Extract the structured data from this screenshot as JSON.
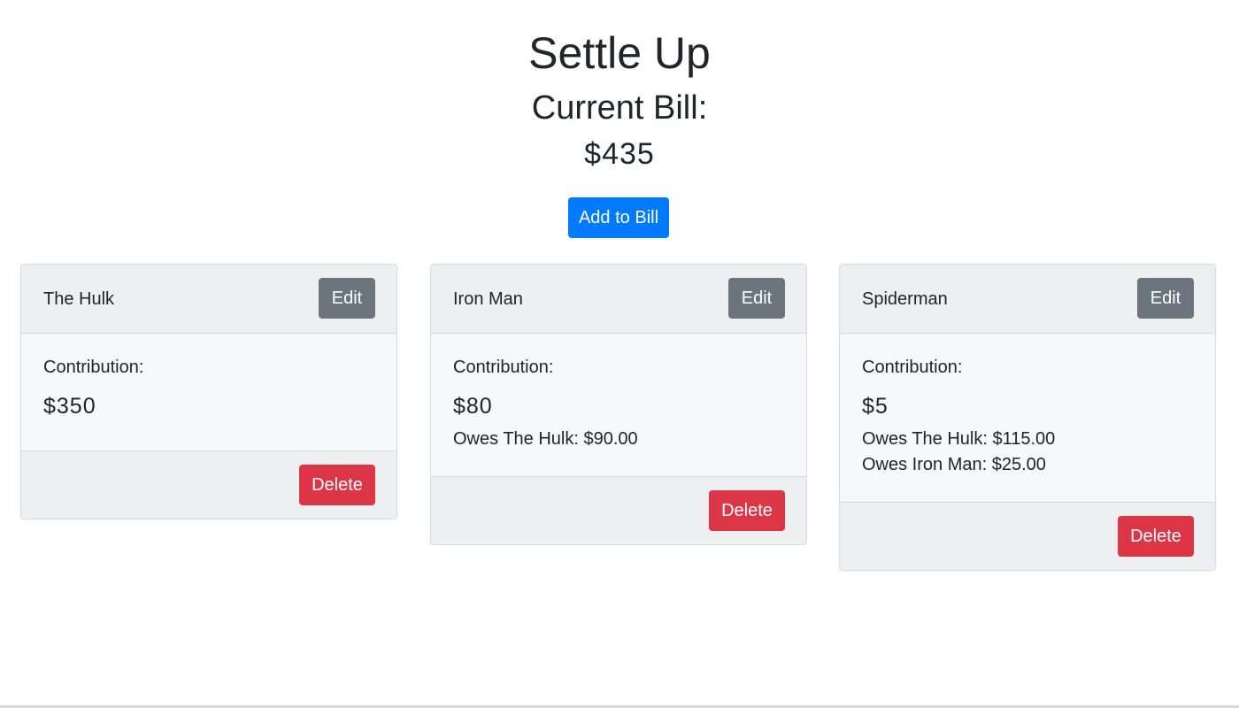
{
  "header": {
    "title": "Settle Up",
    "subtitle": "Current Bill:",
    "total": "$435",
    "add_button_label": "Add to Bill"
  },
  "people": [
    {
      "name": "The Hulk",
      "edit_label": "Edit",
      "contribution_label": "Contribution:",
      "contribution": "$350",
      "owes": [],
      "delete_label": "Delete"
    },
    {
      "name": "Iron Man",
      "edit_label": "Edit",
      "contribution_label": "Contribution:",
      "contribution": "$80",
      "owes": [
        "Owes The Hulk: $90.00"
      ],
      "delete_label": "Delete"
    },
    {
      "name": "Spiderman",
      "edit_label": "Edit",
      "contribution_label": "Contribution:",
      "contribution": "$5",
      "owes": [
        "Owes The Hulk: $115.00",
        "Owes Iron Man: $25.00"
      ],
      "delete_label": "Delete"
    }
  ],
  "colors": {
    "primary": "#007bff",
    "secondary": "#6c757d",
    "danger": "#dc3545"
  }
}
